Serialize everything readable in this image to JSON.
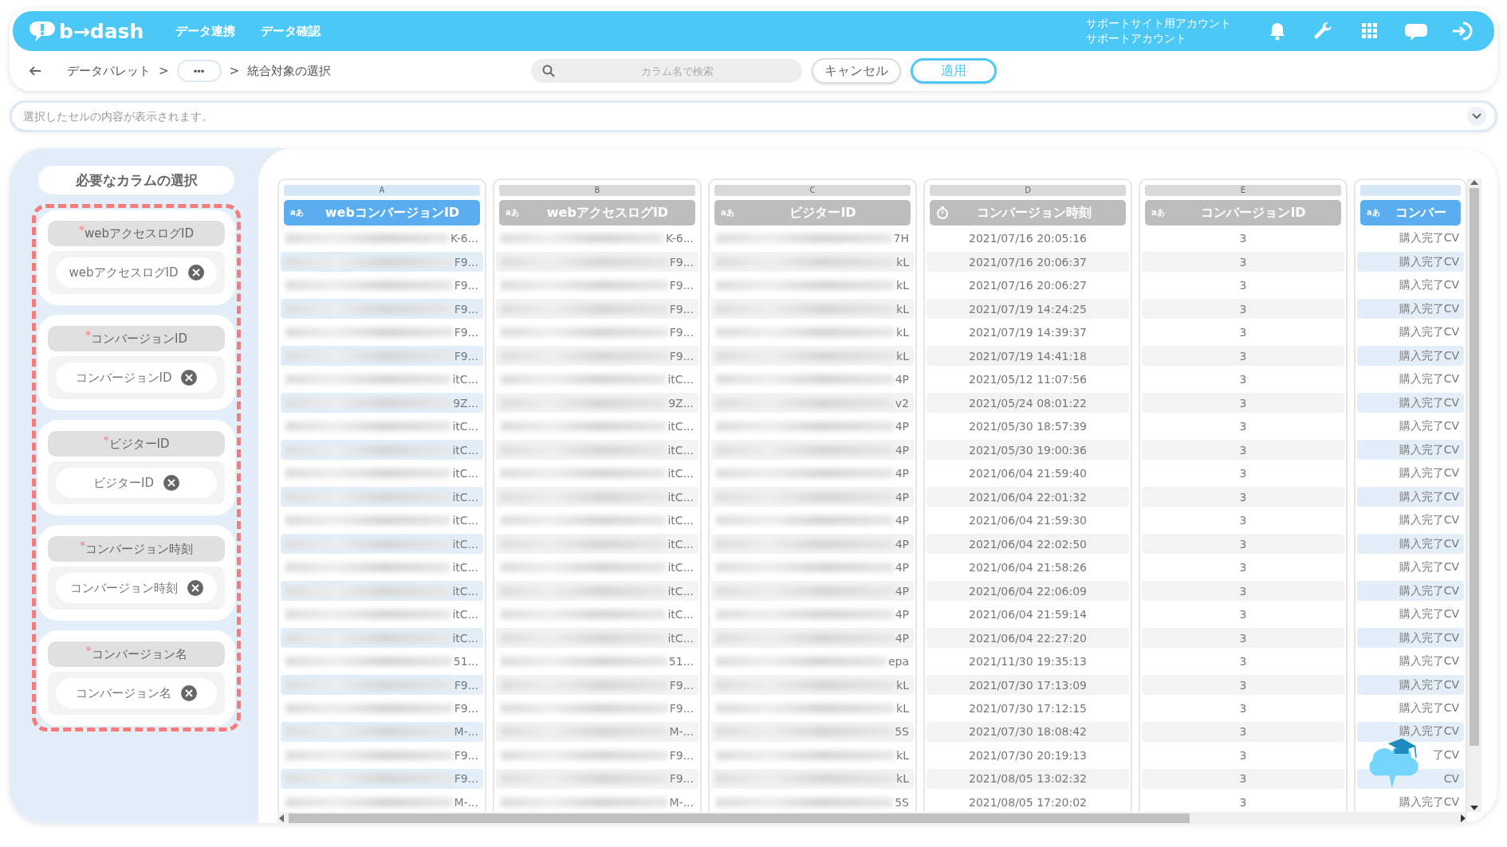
{
  "header": {
    "logo": "b→dash",
    "nav": [
      {
        "label": "データ連携"
      },
      {
        "label": "データ確認"
      }
    ],
    "account": {
      "site": "サポートサイト用アカウント",
      "name": "サポートアカウント"
    }
  },
  "crumbs": [
    {
      "kind": "link",
      "label": "データパレット"
    },
    {
      "kind": "sep",
      "label": ">"
    },
    {
      "kind": "more",
      "label": "•••"
    },
    {
      "kind": "sep",
      "label": ">"
    },
    {
      "kind": "current",
      "label": "統合対象の選択"
    }
  ],
  "search": {
    "placeholder": "カラム名で検索"
  },
  "actions": [
    {
      "label": "キャンセル",
      "primary": false
    },
    {
      "label": "適用",
      "primary": true
    }
  ],
  "cell_viewer": {
    "placeholder": "選択したセルの内容が表示されます。"
  },
  "required_columns": {
    "title": "必要なカラムの選択",
    "items": [
      {
        "mark": "*",
        "label": "webアクセスログID",
        "value": "webアクセスログID"
      },
      {
        "mark": "*",
        "label": "コンバージョンID",
        "value": "コンバージョンID"
      },
      {
        "mark": "*",
        "label": "ビジターID",
        "value": "ビジターID"
      },
      {
        "mark": "*",
        "label": "コンバージョン時刻",
        "value": "コンバージョン時刻"
      },
      {
        "mark": "*",
        "label": "コンバージョン名",
        "value": "コンバージョン名"
      }
    ]
  },
  "table": {
    "columns": [
      {
        "letter": "A",
        "kind": "text",
        "type_label": "aあ",
        "name": "webコンバージョンID",
        "selected": true,
        "masked": true
      },
      {
        "letter": "B",
        "kind": "text",
        "type_label": "aあ",
        "name": "webアクセスログID",
        "selected": false,
        "masked": true
      },
      {
        "letter": "C",
        "kind": "text",
        "type_label": "aあ",
        "name": "ビジターID",
        "selected": false,
        "masked": true
      },
      {
        "letter": "D",
        "kind": "datetime",
        "name": "コンバージョン時刻",
        "selected": false,
        "masked": false
      },
      {
        "letter": "E",
        "kind": "text",
        "type_label": "aあ",
        "name": "コンバージョンID",
        "selected": false,
        "masked": false
      },
      {
        "kind": "text",
        "type_label": "aあ",
        "name": "コンバー",
        "selected": true,
        "masked": false
      }
    ],
    "rows": [
      [
        "K-6...",
        "K-6...",
        "7H",
        "2021/07/16 20:05:16",
        "3",
        "購入完了CV"
      ],
      [
        "F9...",
        "F9...",
        "kL",
        "2021/07/16 20:06:37",
        "3",
        "購入完了CV"
      ],
      [
        "F9...",
        "F9...",
        "kL",
        "2021/07/16 20:06:27",
        "3",
        "購入完了CV"
      ],
      [
        "F9...",
        "F9...",
        "kL",
        "2021/07/19 14:24:25",
        "3",
        "購入完了CV"
      ],
      [
        "F9...",
        "F9...",
        "kL",
        "2021/07/19 14:39:37",
        "3",
        "購入完了CV"
      ],
      [
        "F9...",
        "F9...",
        "kL",
        "2021/07/19 14:41:18",
        "3",
        "購入完了CV"
      ],
      [
        "itC...",
        "itC...",
        "4P",
        "2021/05/12 11:07:56",
        "3",
        "購入完了CV"
      ],
      [
        "9Z...",
        "9Z...",
        "v2",
        "2021/05/24 08:01:22",
        "3",
        "購入完了CV"
      ],
      [
        "itC...",
        "itC...",
        "4P",
        "2021/05/30 18:57:39",
        "3",
        "購入完了CV"
      ],
      [
        "itC...",
        "itC...",
        "4P",
        "2021/05/30 19:00:36",
        "3",
        "購入完了CV"
      ],
      [
        "itC...",
        "itC...",
        "4P",
        "2021/06/04 21:59:40",
        "3",
        "購入完了CV"
      ],
      [
        "itC...",
        "itC...",
        "4P",
        "2021/06/04 22:01:32",
        "3",
        "購入完了CV"
      ],
      [
        "itC...",
        "itC...",
        "4P",
        "2021/06/04 21:59:30",
        "3",
        "購入完了CV"
      ],
      [
        "itC...",
        "itC...",
        "4P",
        "2021/06/04 22:02:50",
        "3",
        "購入完了CV"
      ],
      [
        "itC...",
        "itC...",
        "4P",
        "2021/06/04 21:58:26",
        "3",
        "購入完了CV"
      ],
      [
        "itC...",
        "itC...",
        "4P",
        "2021/06/04 22:06:09",
        "3",
        "購入完了CV"
      ],
      [
        "itC...",
        "itC...",
        "4P",
        "2021/06/04 21:59:14",
        "3",
        "購入完了CV"
      ],
      [
        "itC...",
        "itC...",
        "4P",
        "2021/06/04 22:27:20",
        "3",
        "購入完了CV"
      ],
      [
        "51...",
        "51...",
        "epa",
        "2021/11/30 19:35:13",
        "3",
        "購入完了CV"
      ],
      [
        "F9...",
        "F9...",
        "kL",
        "2021/07/30 17:13:09",
        "3",
        "購入完了CV"
      ],
      [
        "F9...",
        "F9...",
        "kL",
        "2021/07/30 17:12:15",
        "3",
        "購入完了CV"
      ],
      [
        "M-...",
        "M-...",
        "5S",
        "2021/07/30 18:08:42",
        "3",
        "購入完了CV"
      ],
      [
        "F9...",
        "F9...",
        "kL",
        "2021/07/30 20:19:13",
        "3",
        "了CV"
      ],
      [
        "F9...",
        "F9...",
        "kL",
        "2021/08/05 13:02:32",
        "3",
        "CV"
      ],
      [
        "M-...",
        "M-...",
        "5S",
        "2021/08/05 17:20:02",
        "3",
        "購入完了CV"
      ]
    ]
  }
}
